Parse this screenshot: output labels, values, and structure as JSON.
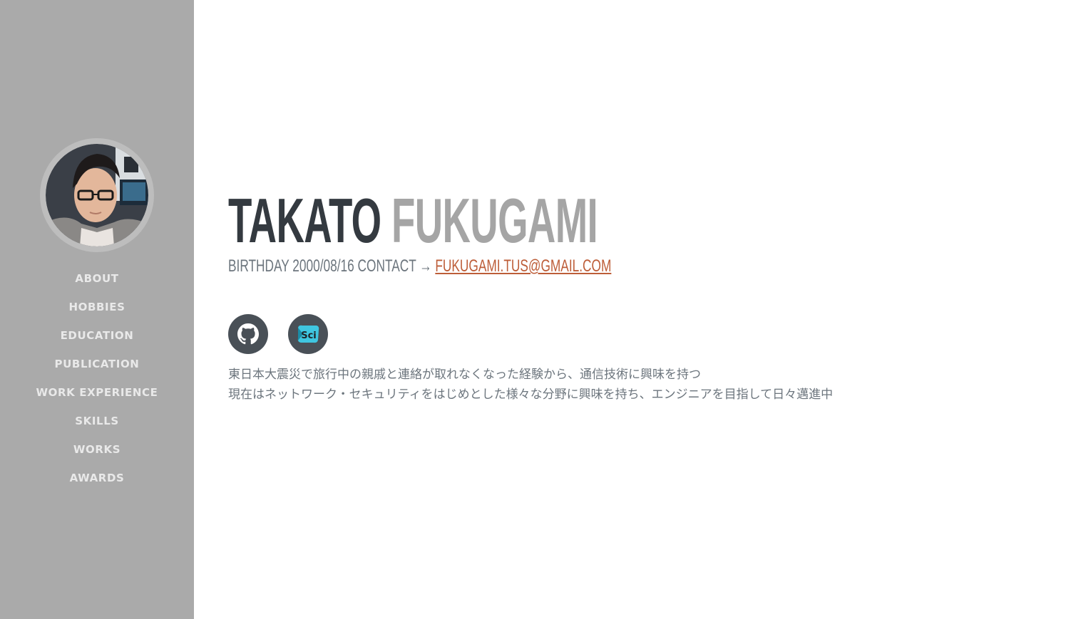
{
  "sidebar": {
    "nav": [
      {
        "label": "ABOUT"
      },
      {
        "label": "HOBBIES"
      },
      {
        "label": "EDUCATION"
      },
      {
        "label": "PUBLICATION"
      },
      {
        "label": "WORK EXPERIENCE"
      },
      {
        "label": "SKILLS"
      },
      {
        "label": "WORKS"
      },
      {
        "label": "AWARDS"
      }
    ]
  },
  "profile": {
    "first_name": "TAKATO",
    "last_name": "FUKUGAMI",
    "subheading_prefix": "BIRTHDAY 2000/08/16 CONTACT → ",
    "email": "FUKUGAMI.TUS@GMAIL.COM",
    "social": [
      {
        "icon": "github-icon"
      },
      {
        "icon": "sci-icon",
        "text": "Sci"
      }
    ],
    "about_lines": [
      "東日本大震災で旅行中の親戚と連絡が取れなくなった経験から、通信技術に興味を持つ",
      "現在はネットワーク・セキュリティをはじめとした様々な分野に興味を持ち、エンジニアを目指して日々邁進中"
    ]
  },
  "colors": {
    "sidebar_bg": "#aaaaaa",
    "name_dark": "#343a40",
    "name_light": "#a5a5a5",
    "accent": "#bd5d38",
    "social_bg": "#495057"
  }
}
